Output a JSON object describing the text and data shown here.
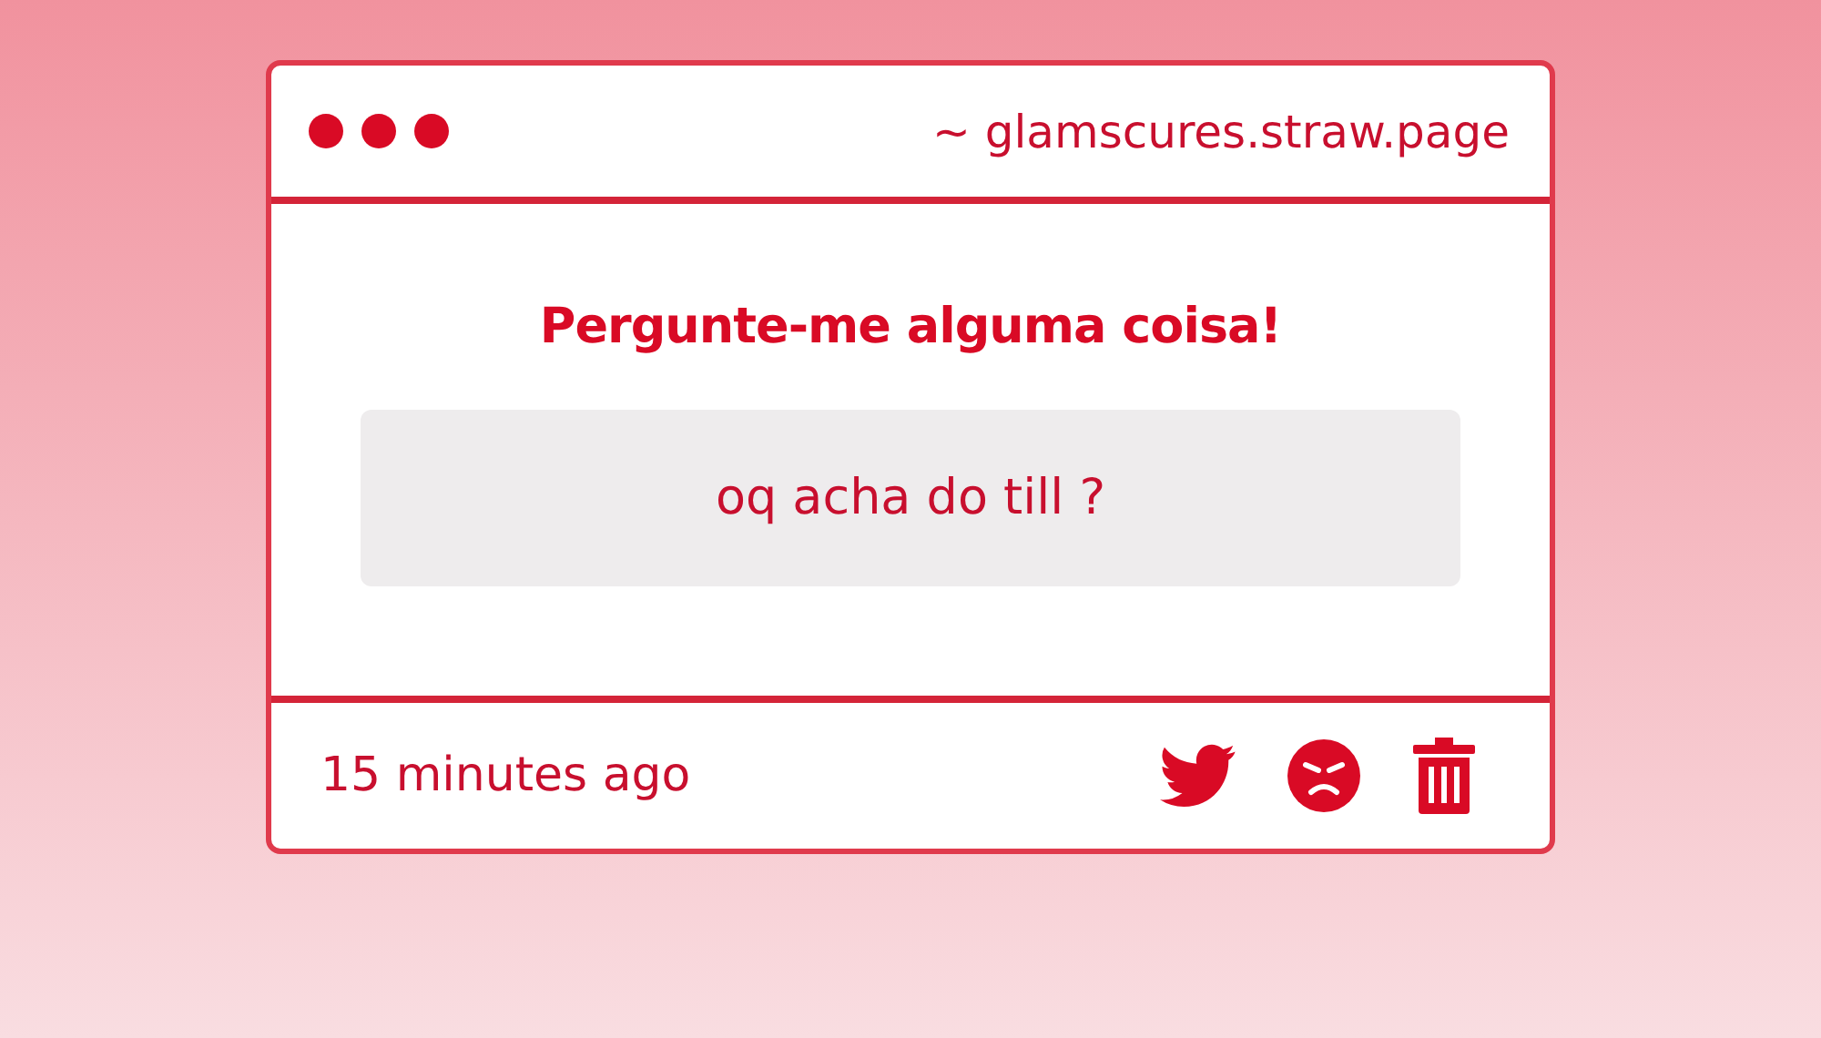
{
  "window": {
    "url": "~ glamscures.straw.page"
  },
  "card": {
    "heading": "Pergunte-me alguma coisa!",
    "question": "oq acha do till ?"
  },
  "footer": {
    "time": "15 minutes ago"
  }
}
